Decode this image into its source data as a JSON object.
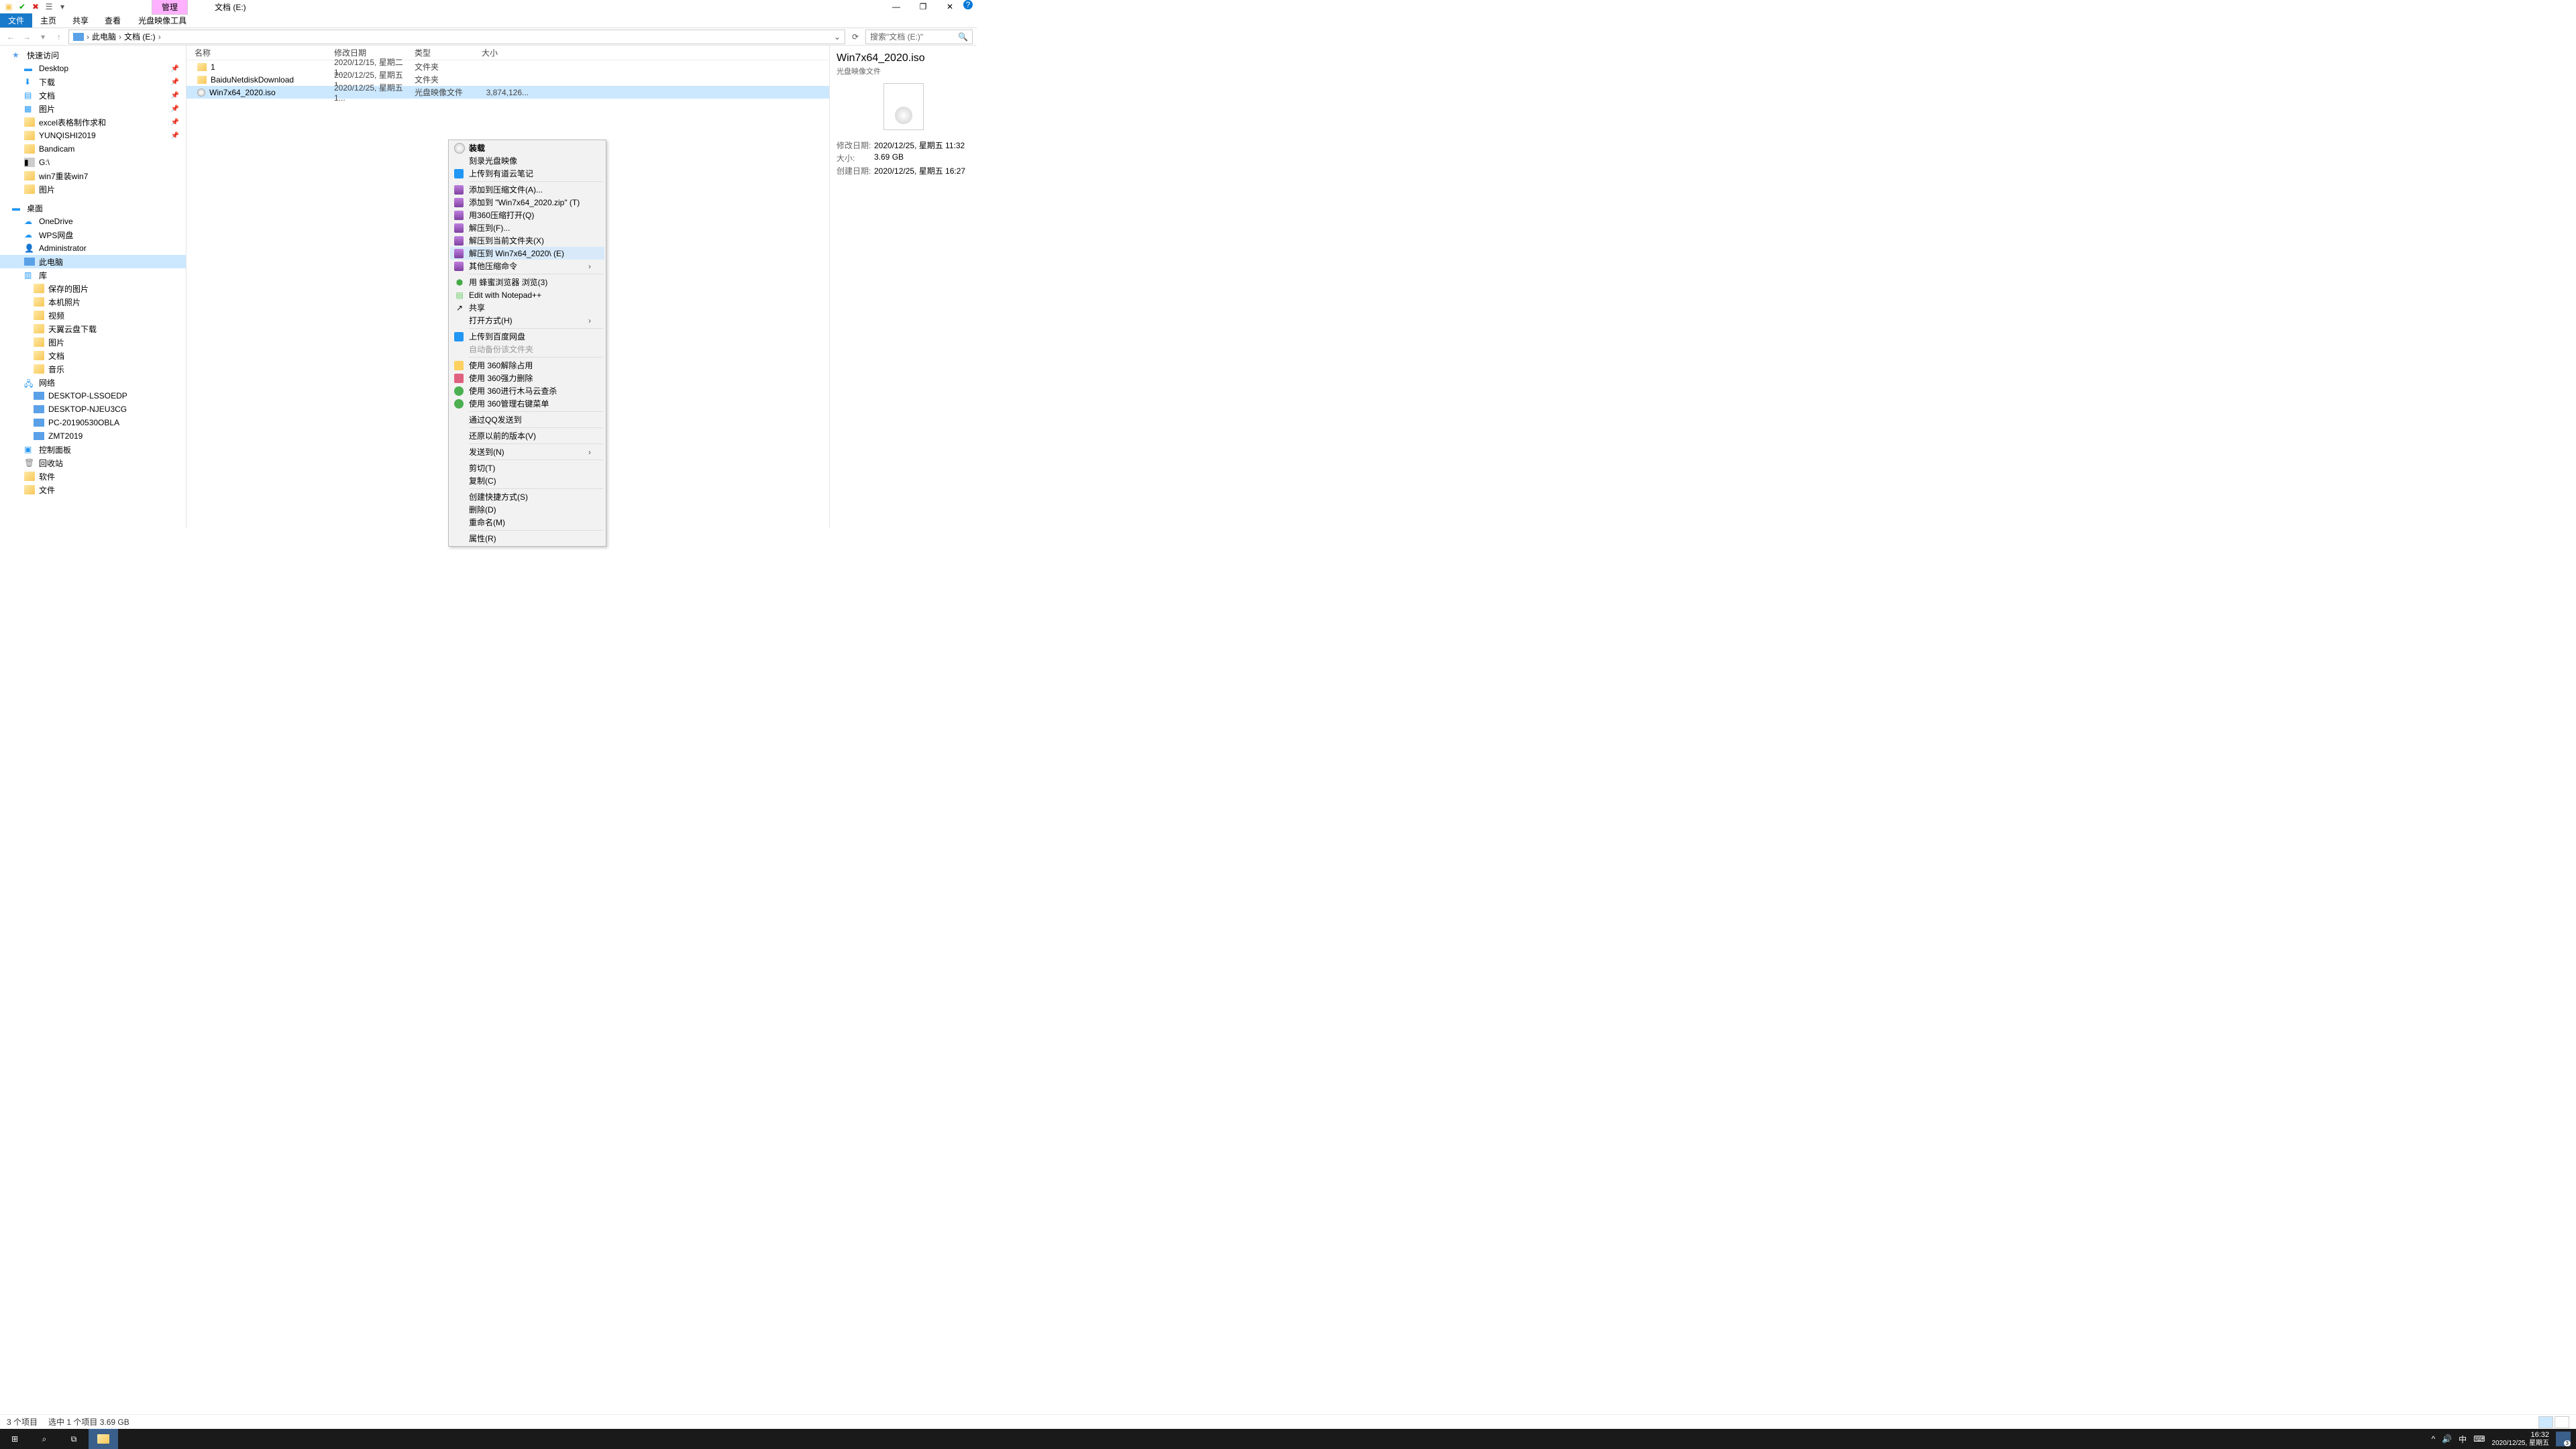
{
  "window": {
    "contextual_tab": "管理",
    "title": "文档 (E:)",
    "minimize": "—",
    "maximize": "❐",
    "close": "✕",
    "help": "?"
  },
  "ribbon": {
    "file": "文件",
    "home": "主页",
    "share": "共享",
    "view": "查看",
    "tool": "光盘映像工具"
  },
  "breadcrumb": {
    "root": "此电脑",
    "drive": "文档 (E:)",
    "sep": "›"
  },
  "search": {
    "placeholder": "搜索\"文档 (E:)\""
  },
  "tree": {
    "quick": "快速访问",
    "desktop": "Desktop",
    "downloads": "下载",
    "docs": "文档",
    "pics": "图片",
    "excel": "excel表格制作求和",
    "yunqishi": "YUNQISHI2019",
    "bandicam": "Bandicam",
    "gdrive": "G:\\",
    "win7re": "win7重装win7",
    "pics2": "图片",
    "desktop2": "桌面",
    "onedrive": "OneDrive",
    "wps": "WPS网盘",
    "admin": "Administrator",
    "thispc": "此电脑",
    "library": "库",
    "savedpics": "保存的图片",
    "localpics": "本机照片",
    "videos": "视频",
    "skydl": "天翼云盘下载",
    "pics3": "图片",
    "docs2": "文档",
    "music": "音乐",
    "network": "网络",
    "pc1": "DESKTOP-LSSOEDP",
    "pc2": "DESKTOP-NJEU3CG",
    "pc3": "PC-20190530OBLA",
    "pc4": "ZMT2019",
    "ctrl": "控制面板",
    "recycle": "回收站",
    "soft": "软件",
    "files": "文件"
  },
  "cols": {
    "name": "名称",
    "date": "修改日期",
    "type": "类型",
    "size": "大小"
  },
  "rows": [
    {
      "name": "1",
      "date": "2020/12/15, 星期二 1...",
      "type": "文件夹",
      "size": ""
    },
    {
      "name": "BaiduNetdiskDownload",
      "date": "2020/12/25, 星期五 1...",
      "type": "文件夹",
      "size": ""
    },
    {
      "name": "Win7x64_2020.iso",
      "date": "2020/12/25, 星期五 1...",
      "type": "光盘映像文件",
      "size": "3,874,126..."
    }
  ],
  "ctx": {
    "mount": "装载",
    "burn": "刻录光盘映像",
    "youdao": "上传到有道云笔记",
    "addarch": "添加到压缩文件(A)...",
    "addzip": "添加到 \"Win7x64_2020.zip\" (T)",
    "open360": "用360压缩打开(Q)",
    "extract": "解压到(F)...",
    "extracthere": "解压到当前文件夹(X)",
    "extractto": "解压到 Win7x64_2020\\ (E)",
    "othercomp": "其他压缩命令",
    "bee": "用 蜂蜜浏览器 浏览(3)",
    "notepad": "Edit with Notepad++",
    "share": "共享",
    "openwith": "打开方式(H)",
    "baidu": "上传到百度网盘",
    "autobak": "自动备份该文件夹",
    "unlock360": "使用 360解除占用",
    "force360": "使用 360强力删除",
    "trojan360": "使用 360进行木马云查杀",
    "mgr360": "使用 360管理右键菜单",
    "qqsend": "通过QQ发送到",
    "restore": "还原以前的版本(V)",
    "sendto": "发送到(N)",
    "cut": "剪切(T)",
    "copy": "复制(C)",
    "shortcut": "创建快捷方式(S)",
    "delete": "删除(D)",
    "rename": "重命名(M)",
    "props": "属性(R)"
  },
  "details": {
    "title": "Win7x64_2020.iso",
    "subtitle": "光盘映像文件",
    "modlabel": "修改日期:",
    "modval": "2020/12/25, 星期五 11:32",
    "sizelabel": "大小:",
    "sizeval": "3.69 GB",
    "createlabel": "创建日期:",
    "createval": "2020/12/25, 星期五 16:27"
  },
  "status": {
    "count": "3 个项目",
    "sel": "选中 1 个项目  3.69 GB"
  },
  "taskbar": {
    "time": "16:32",
    "date": "2020/12/25, 星期五",
    "ime": "中",
    "badge": "3"
  }
}
